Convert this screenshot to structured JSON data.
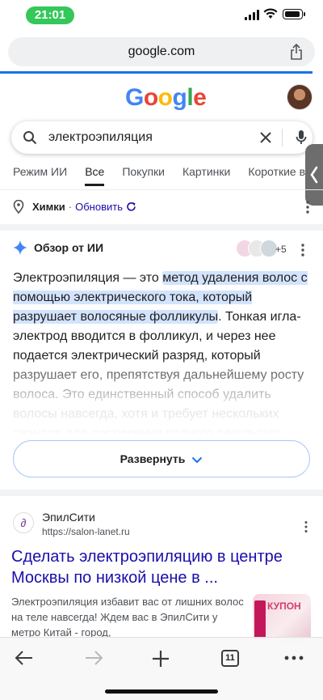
{
  "status": {
    "time": "21:01"
  },
  "browser": {
    "url": "google.com"
  },
  "google": {
    "logo_letters": [
      {
        "ch": "G",
        "color": "#4285F4"
      },
      {
        "ch": "o",
        "color": "#EA4335"
      },
      {
        "ch": "o",
        "color": "#FBBC05"
      },
      {
        "ch": "g",
        "color": "#4285F4"
      },
      {
        "ch": "l",
        "color": "#34A853"
      },
      {
        "ch": "e",
        "color": "#EA4335"
      }
    ],
    "query": "электроэпиляция"
  },
  "tabs": [
    "Режим ИИ",
    "Все",
    "Покупки",
    "Картинки",
    "Короткие в"
  ],
  "location": {
    "city": "Химки",
    "separator": "·",
    "update": "Обновить"
  },
  "ai_overview": {
    "title": "Обзор от ИИ",
    "sources_more": "+5",
    "text_before": "Электроэпиляция — это ",
    "text_highlight": "метод удаления волос с помощью электрического тока, который разрушает волосяные фолликулы",
    "text_after": ". Тонкая игла-электрод вводится в фолликул, и через нее подается электрический разряд, который разрушает его, препятствуя дальнейшему росту волоса. Это единственный способ удалить волосы навсегда, хотя и требует нескольких сеансов для достижения полного результата.",
    "expand_label": "Развернуть"
  },
  "result": {
    "site_name": "ЭпилСити",
    "url": "https://salon-lanet.ru",
    "title": "Сделать электроэпиляцию в центре Москвы по низкой цене в ...",
    "snippet": "Электроэпиляция избавит вас от лишних волос на теле навсегда! Ждем вас в ЭпилСити у метро Китай - город,",
    "thumb_text": "КУПОН"
  },
  "toolbar": {
    "tab_count": "11"
  }
}
